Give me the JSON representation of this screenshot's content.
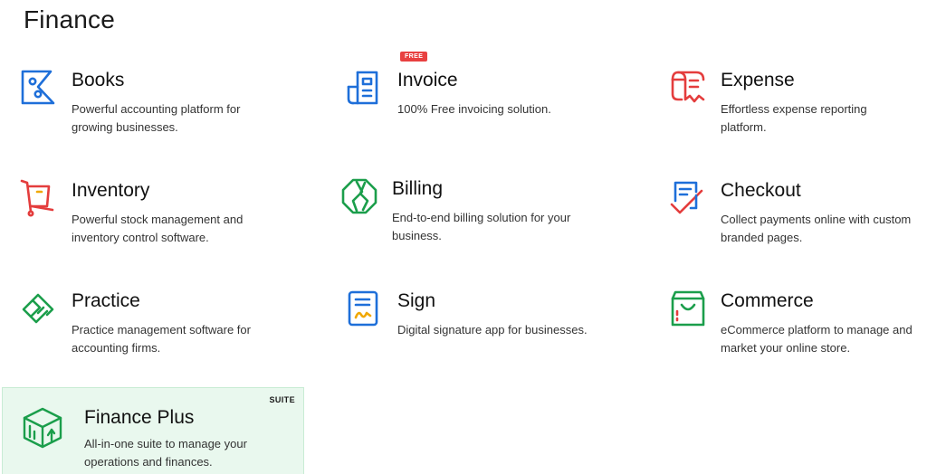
{
  "section": {
    "title": "Finance"
  },
  "colors": {
    "books": "#1e6fd9",
    "invoice": "#1e6fd9",
    "expense": "#e43d3d",
    "inventory": "#e43d3d",
    "billing": "#1b9e4b",
    "checkout": "#1e6fd9",
    "practice": "#1b9e4b",
    "sign": "#1e6fd9",
    "commerce": "#1b9e4b",
    "free_badge": "#e84040",
    "suite_bg": "#e9f8ee"
  },
  "products": [
    {
      "id": "books",
      "icon": "books-icon",
      "name": "Books",
      "description": "Powerful accounting platform for growing businesses."
    },
    {
      "id": "invoice",
      "icon": "invoice-icon",
      "name": "Invoice",
      "badge": "FREE",
      "description": "100% Free invoicing solution."
    },
    {
      "id": "expense",
      "icon": "expense-icon",
      "name": "Expense",
      "description": "Effortless expense reporting platform."
    },
    {
      "id": "inventory",
      "icon": "inventory-icon",
      "name": "Inventory",
      "description": "Powerful stock management and inventory control software."
    },
    {
      "id": "billing",
      "icon": "billing-icon",
      "name": "Billing",
      "description": "End-to-end billing solution for your business."
    },
    {
      "id": "checkout",
      "icon": "checkout-icon",
      "name": "Checkout",
      "description": "Collect payments online with custom branded pages."
    },
    {
      "id": "practice",
      "icon": "practice-icon",
      "name": "Practice",
      "description": "Practice management software for accounting firms."
    },
    {
      "id": "sign",
      "icon": "sign-icon",
      "name": "Sign",
      "description": "Digital signature app for businesses."
    },
    {
      "id": "commerce",
      "icon": "commerce-icon",
      "name": "Commerce",
      "description": "eCommerce platform to manage and market your online store."
    }
  ],
  "suite": {
    "icon": "finance-plus-icon",
    "name": "Finance Plus",
    "badge": "SUITE",
    "description": "All-in-one suite to manage your operations and finances."
  }
}
